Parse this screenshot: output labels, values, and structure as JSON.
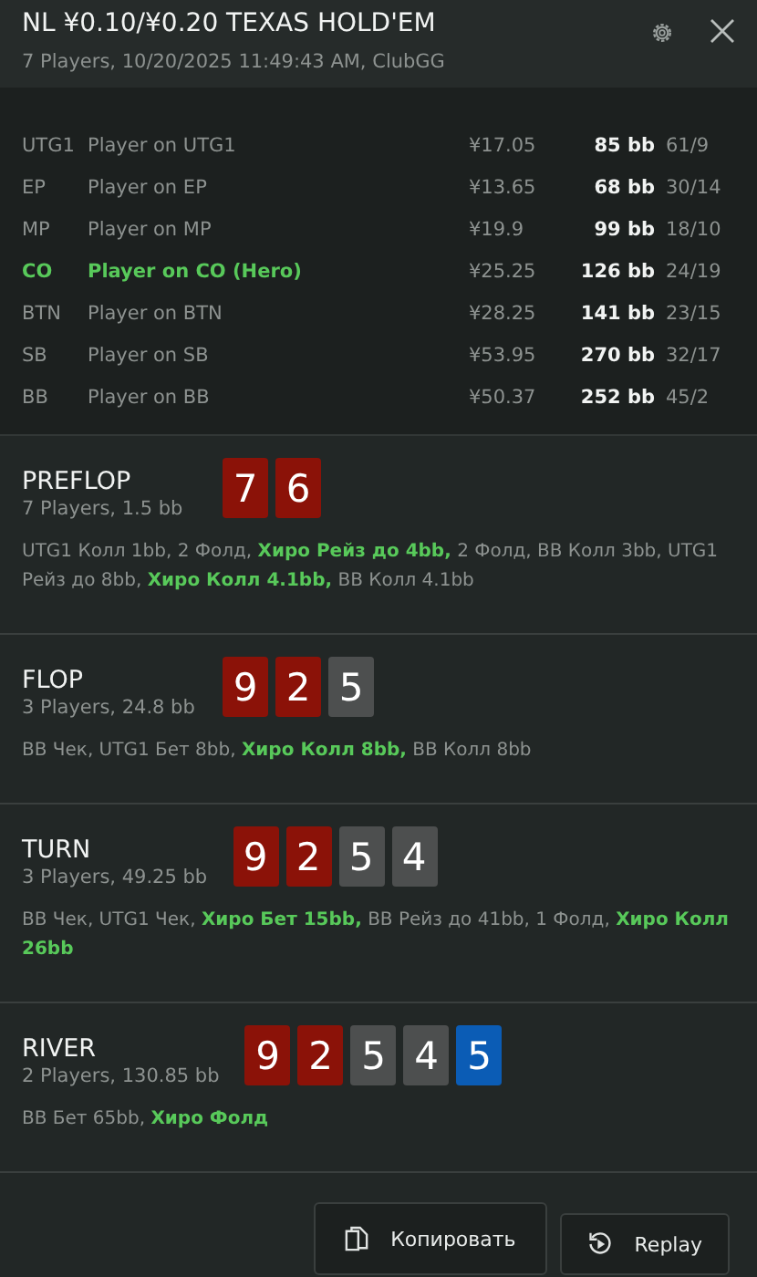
{
  "header": {
    "title": "NL ¥0.10/¥0.20 TEXAS HOLD'EM",
    "subtitle": "7 Players, 10/20/2025 11:49:43 AM, ClubGG"
  },
  "players": [
    {
      "position": "UTG1",
      "name": "Player on UTG1",
      "stack": "¥17.05",
      "bb": "85 bb",
      "stats": "61/9",
      "hero": false
    },
    {
      "position": "EP",
      "name": "Player on EP",
      "stack": "¥13.65",
      "bb": "68 bb",
      "stats": "30/14",
      "hero": false
    },
    {
      "position": "MP",
      "name": "Player on MP",
      "stack": "¥19.9",
      "bb": "99 bb",
      "stats": "18/10",
      "hero": false
    },
    {
      "position": "CO",
      "name": "Player on CO (Hero)",
      "stack": "¥25.25",
      "bb": "126 bb",
      "stats": "24/19",
      "hero": true
    },
    {
      "position": "BTN",
      "name": "Player on BTN",
      "stack": "¥28.25",
      "bb": "141 bb",
      "stats": "23/15",
      "hero": false
    },
    {
      "position": "SB",
      "name": "Player on SB",
      "stack": "¥53.95",
      "bb": "270 bb",
      "stats": "32/17",
      "hero": false
    },
    {
      "position": "BB",
      "name": "Player on BB",
      "stack": "¥50.37",
      "bb": "252 bb",
      "stats": "45/2",
      "hero": false
    }
  ],
  "streets": [
    {
      "name": "PREFLOP",
      "info": "7 Players, 1.5 bb",
      "cards": [
        {
          "rank": "7",
          "color": "#8b1208"
        },
        {
          "rank": "6",
          "color": "#8b1208"
        }
      ],
      "actions": "UTG1 Колл 1bb, 2 Фолд, **Хиро Рейз до 4bb,** 2 Фолд, BB Колл 3bb, UTG1 Рейз до 8bb, **Хиро Колл 4.1bb,** BB Колл 4.1bb"
    },
    {
      "name": "FLOP",
      "info": "3 Players, 24.8 bb",
      "cards": [
        {
          "rank": "9",
          "color": "#8b1208"
        },
        {
          "rank": "2",
          "color": "#8b1208"
        },
        {
          "rank": "5",
          "color": "#4d4f4f"
        }
      ],
      "actions": "BB Чек, UTG1 Бет 8bb, **Хиро Колл 8bb,** BB Колл 8bb"
    },
    {
      "name": "TURN",
      "info": "3 Players, 49.25 bb",
      "cards": [
        {
          "rank": "9",
          "color": "#8b1208"
        },
        {
          "rank": "2",
          "color": "#8b1208"
        },
        {
          "rank": "5",
          "color": "#4d4f4f"
        },
        {
          "rank": "4",
          "color": "#4d4f4f"
        }
      ],
      "actions": "BB Чек, UTG1 Чек, **Хиро Бет 15bb,** BB Рейз до 41bb, 1 Фолд, **Хиро Колл 26bb**"
    },
    {
      "name": "RIVER",
      "info": "2 Players, 130.85 bb",
      "cards": [
        {
          "rank": "9",
          "color": "#8b1208"
        },
        {
          "rank": "2",
          "color": "#8b1208"
        },
        {
          "rank": "5",
          "color": "#4d4f4f"
        },
        {
          "rank": "4",
          "color": "#4d4f4f"
        },
        {
          "rank": "5",
          "color": "#0b5cb5"
        }
      ],
      "actions": "BB Бет 65bb, **Хиро Фолд**"
    }
  ],
  "buttons": [
    {
      "kind": "copy",
      "label": "Копировать"
    },
    {
      "kind": "replay",
      "label": "Replay"
    }
  ]
}
